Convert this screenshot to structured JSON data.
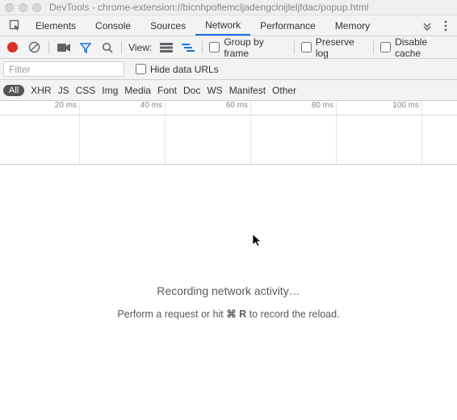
{
  "window": {
    "title": "DevTools - chrome-extension://bicnhpoflemcljadengclnijleljfdac/popup.html"
  },
  "tabs": {
    "items": [
      "Elements",
      "Console",
      "Sources",
      "Network",
      "Performance",
      "Memory"
    ],
    "active_index": 3
  },
  "toolbar": {
    "view_label": "View:",
    "group_by_frame": "Group by frame",
    "preserve_log": "Preserve log",
    "disable_cache": "Disable cache"
  },
  "filter": {
    "placeholder": "Filter",
    "hide_data_urls": "Hide data URLs"
  },
  "types": {
    "all": "All",
    "items": [
      "XHR",
      "JS",
      "CSS",
      "Img",
      "Media",
      "Font",
      "Doc",
      "WS",
      "Manifest",
      "Other"
    ]
  },
  "timeline": {
    "ticks": [
      "20 ms",
      "40 ms",
      "60 ms",
      "80 ms",
      "100 ms"
    ]
  },
  "empty": {
    "heading": "Recording network activity…",
    "hint_prefix": "Perform a request or hit ",
    "hint_shortcut": "⌘ R",
    "hint_suffix": " to record the reload."
  }
}
